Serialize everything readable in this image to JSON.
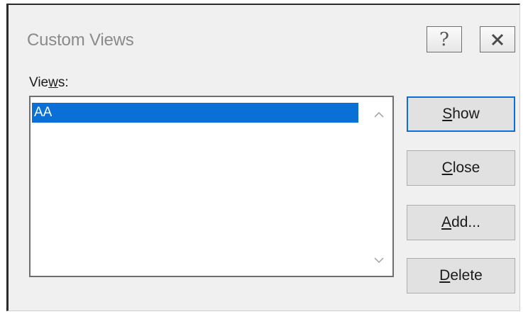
{
  "dialog": {
    "title": "Custom Views",
    "help_glyph": "?",
    "close_icon": "close-x-icon"
  },
  "views": {
    "label_pre": "Vie",
    "label_mnemonic": "w",
    "label_post": "s:",
    "items": [
      "AA"
    ],
    "selected_index": 0
  },
  "buttons": {
    "show": {
      "mnemonic": "S",
      "rest": "how"
    },
    "close": {
      "mnemonic": "C",
      "rest": "lose"
    },
    "add": {
      "mnemonic": "A",
      "rest": "dd..."
    },
    "delete": {
      "mnemonic": "D",
      "rest": "elete"
    }
  },
  "colors": {
    "selection": "#0a6fd6",
    "default_button_border": "#0a6fd6",
    "dialog_bg": "#f0f0f0"
  }
}
